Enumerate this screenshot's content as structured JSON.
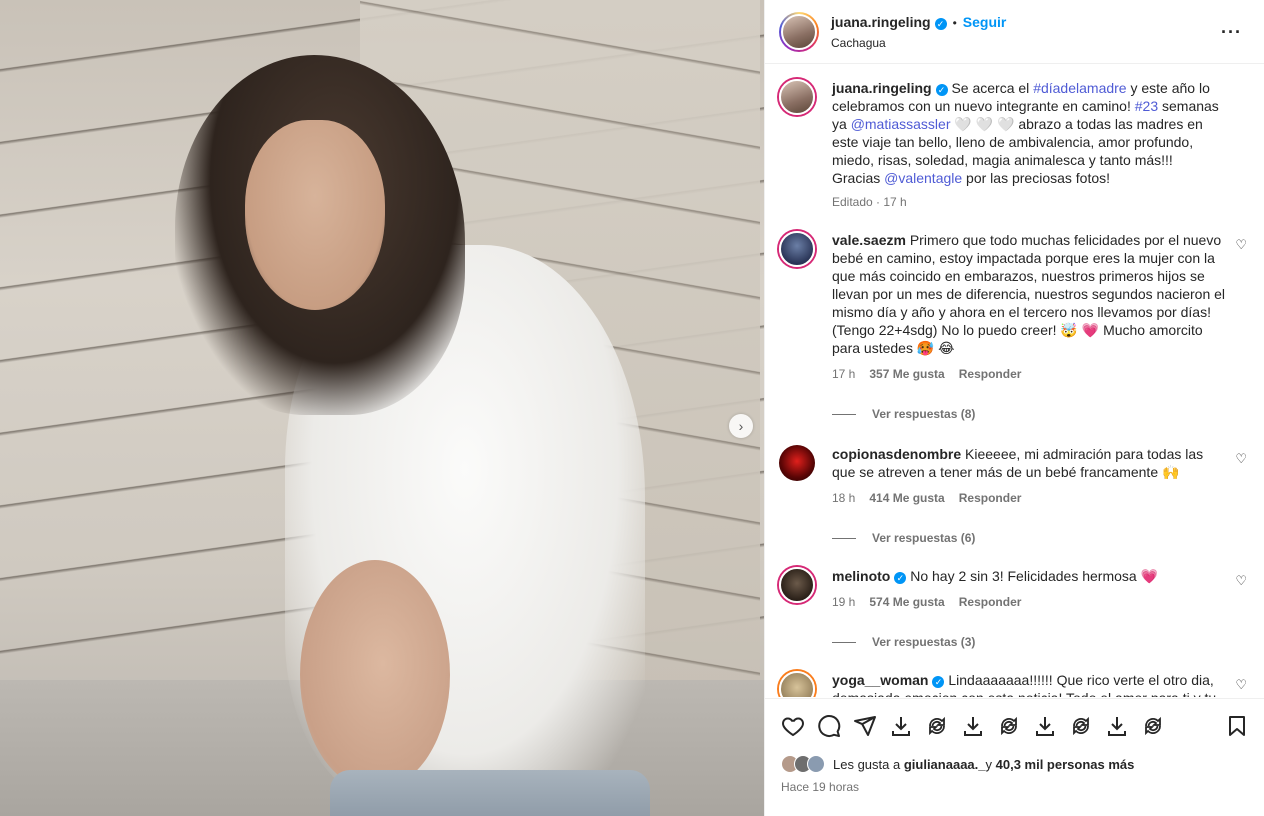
{
  "post": {
    "username": "juana.ringeling",
    "follow_label": "Seguir",
    "location": "Cachagua",
    "more_icon": "more-options-icon"
  },
  "caption": {
    "username": "juana.ringeling",
    "text_1": "Se acerca el ",
    "hashtag_1": "#díadelamadre",
    "text_2": " y este año lo celebramos con un nuevo integrante en camino! ",
    "hashtag_2": "#23",
    "text_3": " semanas ya ",
    "mention_1": "@matiassassler",
    "text_4": " 🤍 🤍 🤍 abrazo a todas las madres en este viaje tan bello, lleno de ambivalencia, amor profundo, miedo, risas, soledad, magia animalesca y tanto más!!!",
    "text_5": "Gracias ",
    "mention_2": "@valentagle",
    "text_6": " por las preciosas fotos!",
    "edited": "Editado · 17 h"
  },
  "comments": [
    {
      "username": "vale.saezm",
      "verified": false,
      "text": "Primero que todo muchas felicidades por el nuevo bebé en camino, estoy impactada porque eres la mujer con la que más coincido en embarazos, nuestros primeros hijos se llevan por un mes de diferencia, nuestros segundos nacieron el mismo día y año y ahora en el tercero nos llevamos por días! (Tengo 22+4sdg) No lo puedo creer! 🤯 💗 Mucho amorcito para ustedes 🥵 😂",
      "time": "17 h",
      "likes": "357 Me gusta",
      "reply": "Responder",
      "view_replies": "Ver respuestas (8)"
    },
    {
      "username": "copionasdenombre",
      "verified": false,
      "text": "Kieeeee, mi admiración para todas las que se atreven a tener más de un bebé francamente 🙌",
      "time": "18 h",
      "likes": "414 Me gusta",
      "reply": "Responder",
      "view_replies": "Ver respuestas (6)"
    },
    {
      "username": "melinoto",
      "verified": true,
      "text": "No hay 2 sin 3! Felicidades hermosa 💗",
      "time": "19 h",
      "likes": "574 Me gusta",
      "reply": "Responder",
      "view_replies": "Ver respuestas (3)"
    },
    {
      "username": "yoga__woman",
      "verified": true,
      "text": "Lindaaaaaaa!!!!!! Que rico verte el otro dia, demasiada emocion con esta noticia! Todo el amor para ti y tu"
    }
  ],
  "footer": {
    "likes_prefix": "Les gusta a ",
    "likes_user": "giulianaaaa._",
    "likes_mid": " y ",
    "likes_count": "40,3 mil personas más",
    "time": "Hace 19 horas"
  },
  "colors": {
    "accent": "#0095f6",
    "text": "#262626",
    "muted": "#737373",
    "hashtag": "#4f5bd5"
  }
}
